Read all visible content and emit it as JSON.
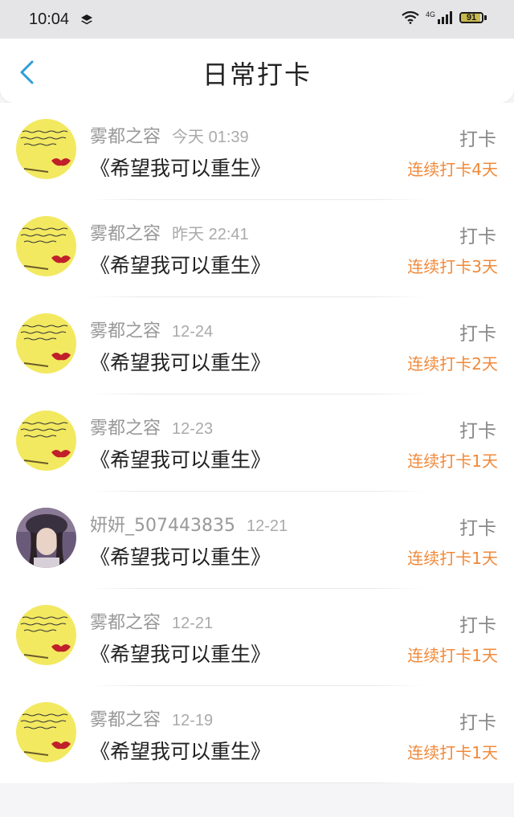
{
  "status_bar": {
    "time": "10:04",
    "network": "4G",
    "battery_level": "91",
    "battery_fraction": 0.91,
    "icons": [
      "layers-icon",
      "wifi-icon",
      "signal-icon",
      "battery-icon"
    ]
  },
  "nav": {
    "title": "日常打卡",
    "back_icon": "chevron-left-icon",
    "accent": "#2d9cdb"
  },
  "colors": {
    "streak": "#f0893a",
    "username": "#999999",
    "book": "#222222",
    "avatar_yellow": "#f2e961"
  },
  "entries": [
    {
      "user": "雾都之容",
      "time": "今天 01:39",
      "book": "《希望我可以重生》",
      "action": "打卡",
      "streak": "连续打卡4天",
      "avatar": "yellow-note-avatar"
    },
    {
      "user": "雾都之容",
      "time": "昨天 22:41",
      "book": "《希望我可以重生》",
      "action": "打卡",
      "streak": "连续打卡3天",
      "avatar": "yellow-note-avatar"
    },
    {
      "user": "雾都之容",
      "time": "12-24",
      "book": "《希望我可以重生》",
      "action": "打卡",
      "streak": "连续打卡2天",
      "avatar": "yellow-note-avatar"
    },
    {
      "user": "雾都之容",
      "time": "12-23",
      "book": "《希望我可以重生》",
      "action": "打卡",
      "streak": "连续打卡1天",
      "avatar": "yellow-note-avatar"
    },
    {
      "user": "妍妍_507443835",
      "time": "12-21",
      "book": "《希望我可以重生》",
      "action": "打卡",
      "streak": "连续打卡1天",
      "avatar": "girl-photo-avatar"
    },
    {
      "user": "雾都之容",
      "time": "12-21",
      "book": "《希望我可以重生》",
      "action": "打卡",
      "streak": "连续打卡1天",
      "avatar": "yellow-note-avatar"
    },
    {
      "user": "雾都之容",
      "time": "12-19",
      "book": "《希望我可以重生》",
      "action": "打卡",
      "streak": "连续打卡1天",
      "avatar": "yellow-note-avatar"
    }
  ]
}
